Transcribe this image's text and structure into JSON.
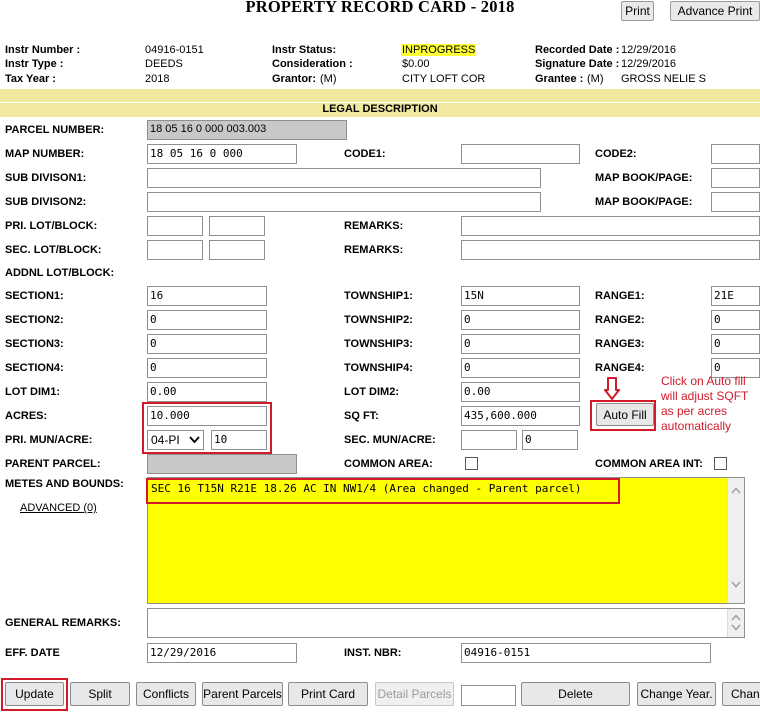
{
  "title": "PROPERTY RECORD CARD - 2018",
  "top_buttons": {
    "print": "Print",
    "advance_print": "Advance Print"
  },
  "header": {
    "instr_number": {
      "label": "Instr Number :",
      "value": "04916-0151"
    },
    "instr_type": {
      "label": "Instr Type :",
      "value": "DEEDS"
    },
    "tax_year": {
      "label": "Tax Year :",
      "value": "2018"
    },
    "instr_status": {
      "label": "Instr Status:",
      "value": "INPROGRESS"
    },
    "consideration": {
      "label": "Consideration :",
      "value": "$0.00"
    },
    "grantor": {
      "label": "Grantor:",
      "prefix": "(M)",
      "value": "CITY LOFT COR"
    },
    "recorded_date": {
      "label": "Recorded Date :",
      "value": "12/29/2016"
    },
    "signature_date": {
      "label": "Signature Date :",
      "value": "12/29/2016"
    },
    "grantee": {
      "label": "Grantee :",
      "prefix": "(M)",
      "value": "GROSS NELIE S"
    }
  },
  "legal_description_header": "LEGAL DESCRIPTION",
  "labels": {
    "parcel_number": "PARCEL NUMBER:",
    "map_number": "MAP NUMBER:",
    "code1": "CODE1:",
    "code2": "CODE2:",
    "sub_division1": "SUB DIVISON1:",
    "map_book_page_1": "MAP BOOK/PAGE:",
    "sub_division2": "SUB DIVISON2:",
    "map_book_page_2": "MAP BOOK/PAGE:",
    "pri_lot_block": "PRI. LOT/BLOCK:",
    "remarks_1": "REMARKS:",
    "sec_lot_block": "SEC. LOT/BLOCK:",
    "remarks_2": "REMARKS:",
    "addnl_lot_block": "ADDNL LOT/BLOCK:",
    "section1": "SECTION1:",
    "township1": "TOWNSHIP1:",
    "range1": "RANGE1:",
    "section2": "SECTION2:",
    "township2": "TOWNSHIP2:",
    "range2": "RANGE2:",
    "section3": "SECTION3:",
    "township3": "TOWNSHIP3:",
    "range3": "RANGE3:",
    "section4": "SECTION4:",
    "township4": "TOWNSHIP4:",
    "range4": "RANGE4:",
    "lot_dim1": "LOT DIM1:",
    "lot_dim2": "LOT DIM2:",
    "acres": "ACRES:",
    "sq_ft": "SQ FT:",
    "pri_mun_acre": "PRI. MUN/ACRE:",
    "sec_mun_acre": "SEC. MUN/ACRE:",
    "parent_parcel": "PARENT PARCEL:",
    "common_area": "COMMON AREA:",
    "common_area_int": "COMMON AREA INT:",
    "metes_and_bounds": "METES AND BOUNDS:",
    "advanced_link": "ADVANCED (0)",
    "general_remarks": "GENERAL REMARKS:",
    "eff_date": "EFF. DATE",
    "inst_nbr": "INST. NBR:"
  },
  "values": {
    "parcel_number": "18 05 16 0 000 003.003",
    "map_number": "18 05 16 0 000",
    "code1": "",
    "code2": "",
    "sub_division1": "",
    "map_book_page_1": "",
    "sub_division2": "",
    "map_book_page_2": "",
    "pri_lot": "",
    "pri_block": "",
    "remarks_1": "",
    "sec_lot": "",
    "sec_block": "",
    "remarks_2": "",
    "section1": "16",
    "township1": "15N",
    "range1": "21E",
    "section2": "0",
    "township2": "0",
    "range2": "0",
    "section3": "0",
    "township3": "0",
    "range3": "0",
    "section4": "0",
    "township4": "0",
    "range4": "0",
    "lot_dim1": "0.00",
    "lot_dim2": "0.00",
    "acres": "10.000",
    "sq_ft": "435,600.000",
    "pri_mun_select": "04-PI",
    "pri_mun_value": "10",
    "sec_mun_1": "",
    "sec_mun_2": "0",
    "parent_parcel": "",
    "metes_and_bounds": "SEC 16 T15N R21E 18.26 AC IN NW1/4 (Area changed - Parent parcel)",
    "general_remarks": "",
    "eff_date": "12/29/2016",
    "inst_nbr": "04916-0151",
    "footer_input": ""
  },
  "auto_fill_button": "Auto Fill",
  "annotation_note": "Click on Auto fill will adjust SQFT as per acres automatically",
  "bottom_buttons": {
    "update": "Update",
    "split": "Split",
    "conflicts": "Conflicts",
    "parent_parcels": "Parent Parcels",
    "print_card": "Print Card",
    "detail_parcels": "Detail Parcels",
    "delete": "Delete",
    "change_year": "Change Year.",
    "change_cut": "Chang"
  },
  "colors": {
    "highlight_yellow": "#ffff33",
    "textarea_yellow": "#ffff00",
    "band": "#f2e9a0",
    "annotation_red": "#d11a2a",
    "disabled_field": "#c8c8c8"
  },
  "icons": {
    "dropdown": "chevron-down-icon",
    "auto_fill_arrow": "down-arrow-icon",
    "scroll_up": "chevron-up-icon",
    "scroll_down": "chevron-down-icon"
  }
}
